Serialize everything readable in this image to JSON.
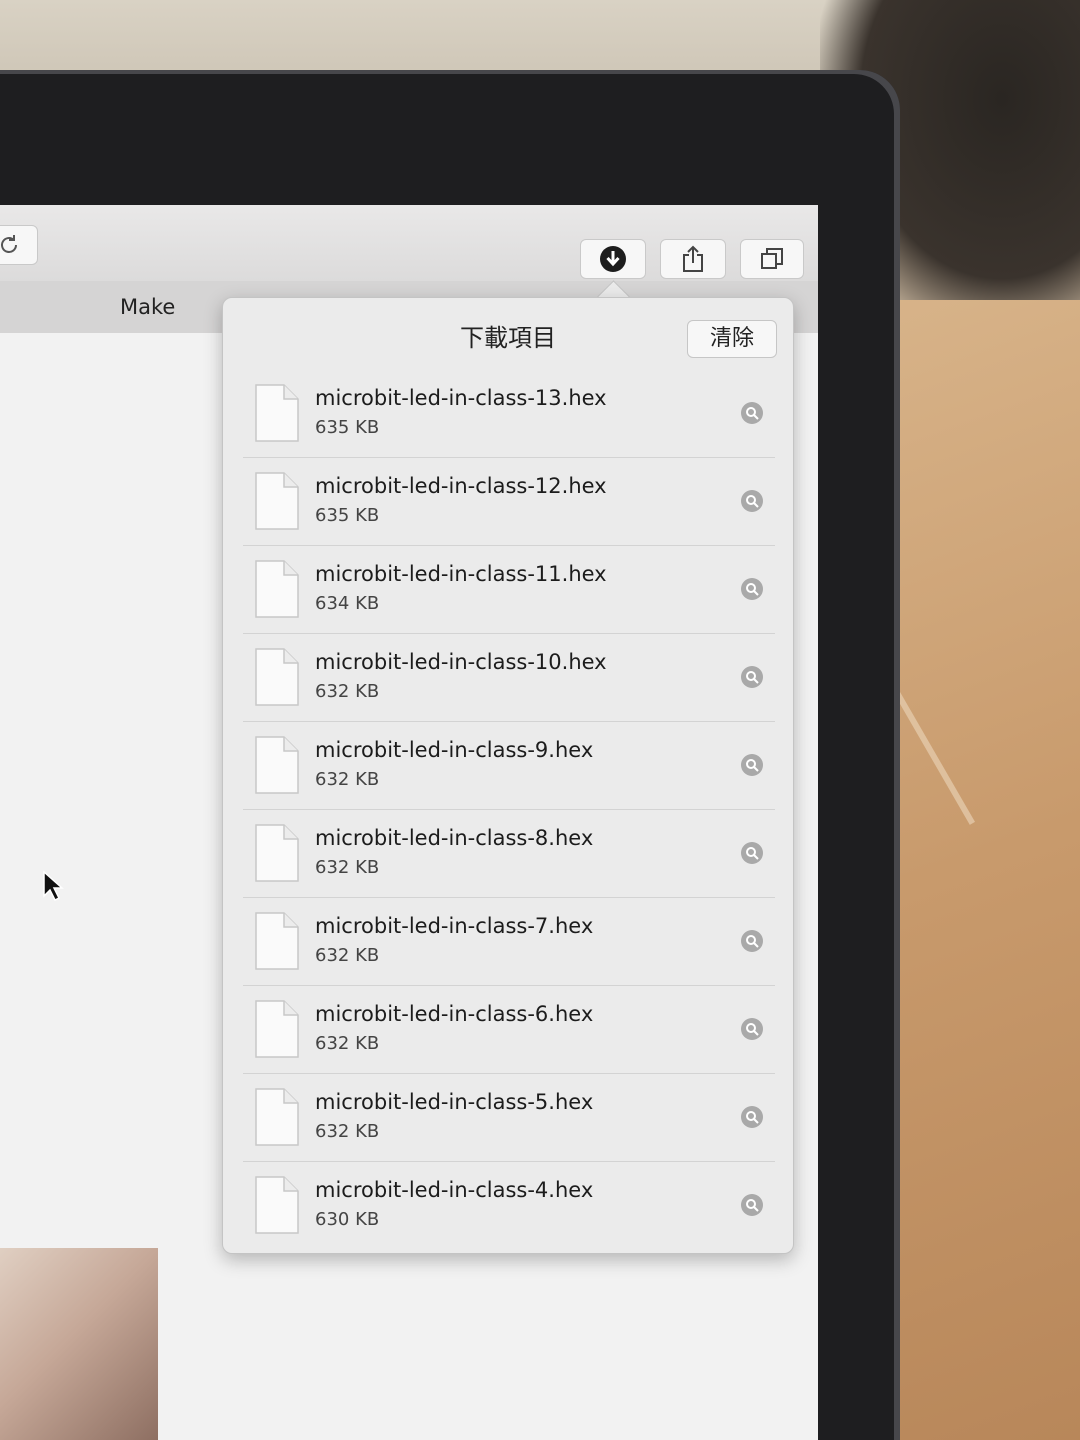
{
  "toolbar": {
    "reload_icon": "reload-icon",
    "download_icon": "download-arrow-icon",
    "share_icon": "share-icon",
    "tabs_icon": "tab-overview-icon"
  },
  "tab": {
    "label": "Make"
  },
  "downloads": {
    "title": "下載項目",
    "clear_label": "清除",
    "items": [
      {
        "name": "microbit-led-in-class-13.hex",
        "size": "635 KB"
      },
      {
        "name": "microbit-led-in-class-12.hex",
        "size": "635 KB"
      },
      {
        "name": "microbit-led-in-class-11.hex",
        "size": "634 KB"
      },
      {
        "name": "microbit-led-in-class-10.hex",
        "size": "632 KB"
      },
      {
        "name": "microbit-led-in-class-9.hex",
        "size": "632 KB"
      },
      {
        "name": "microbit-led-in-class-8.hex",
        "size": "632 KB"
      },
      {
        "name": "microbit-led-in-class-7.hex",
        "size": "632 KB"
      },
      {
        "name": "microbit-led-in-class-6.hex",
        "size": "632 KB"
      },
      {
        "name": "microbit-led-in-class-5.hex",
        "size": "632 KB"
      },
      {
        "name": "microbit-led-in-class-4.hex",
        "size": "630 KB"
      }
    ]
  }
}
